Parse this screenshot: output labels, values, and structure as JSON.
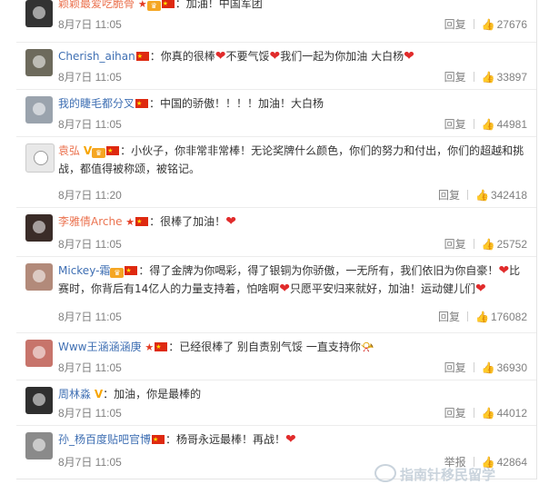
{
  "comments": [
    {
      "username": "颖颖最爱吃脆骨",
      "name_color": "#eb7350",
      "badges": [
        "star",
        "crown",
        "flag"
      ],
      "text": "：加油！中国军团",
      "date": "8月7日 11:05",
      "reply": "回复",
      "likes": "27676",
      "avatar_color": "#333333",
      "avatar_icon": "panda-avatar"
    },
    {
      "username": "Cherish_aihan",
      "name_color": "#3f6fb3",
      "badges": [
        "flag"
      ],
      "text_parts": [
        "：你真的很棒",
        "不要气馁",
        "我们一起为你加油 大白杨",
        ""
      ],
      "date": "8月7日 11:05",
      "reply": "回复",
      "likes": "33897",
      "avatar_color": "#6d6a5c",
      "avatar_icon": "user-avatar"
    },
    {
      "username": "我的睫毛都分叉",
      "name_color": "#3f6fb3",
      "badges": [
        "flag"
      ],
      "text": "：中国的骄傲！！！！加油！大白杨",
      "date": "8月7日 11:05",
      "reply": "回复",
      "likes": "44981",
      "avatar_color": "#9aa3ad",
      "avatar_icon": "user-avatar"
    },
    {
      "username": "袁弘",
      "name_color": "#eb7350",
      "badges": [
        "v",
        "crown",
        "flag"
      ],
      "text": "：小伙子，你非常非常棒！无论奖牌什么颜色，你们的努力和付出，你们的超越和挑战，都值得被称颂，被铭记。",
      "date": "8月7日 11:20",
      "reply": "回复",
      "likes": "342418",
      "avatar_color": "#d8d8d8",
      "avatar_icon": "cat-sketch-avatar"
    },
    {
      "username": "李雅倩Arche",
      "name_color": "#eb7350",
      "badges": [
        "star",
        "flag"
      ],
      "text": "：很棒了加油！",
      "date": "8月7日 11:05",
      "reply": "回复",
      "likes": "25752",
      "avatar_color": "#3a2c28",
      "avatar_icon": "user-avatar"
    },
    {
      "username": "Mickey-霜",
      "name_color": "#3f6fb3",
      "badges": [
        "crown",
        "flag"
      ],
      "text_parts": [
        "：得了金牌为你喝彩，得了银铜为你骄傲，一无所有，我们依旧为你自豪！",
        "比赛时，你背后有14亿人的力量支持着，怕啥啊",
        "只愿平安归来就好，加油！运动健儿们",
        ""
      ],
      "date": "8月7日 11:05",
      "reply": "回复",
      "likes": "176082",
      "avatar_color": "#b28a7a",
      "avatar_icon": "user-avatar"
    },
    {
      "username": "Www王涵涵涵庚",
      "name_color": "#3f6fb3",
      "badges": [
        "star",
        "flag"
      ],
      "text": "：已经很棒了 别自责别气馁 一直支持你",
      "date": "8月7日 11:05",
      "reply": "回复",
      "likes": "36930",
      "avatar_color": "#c7746b",
      "avatar_icon": "user-avatar"
    },
    {
      "username": "周林淼",
      "name_color": "#3f6fb3",
      "badges": [
        "v"
      ],
      "text": "：加油，你是最棒的",
      "date": "8月7日 11:05",
      "reply": "回复",
      "likes": "44012",
      "avatar_color": "#2f2f2f",
      "avatar_icon": "user-avatar"
    },
    {
      "username": "孙_杨百度贴吧官博",
      "name_color": "#3f6fb3",
      "badges": [
        "flag"
      ],
      "text": "：杨哥永远最棒！再战！",
      "date": "8月7日 11:05",
      "reply": "举报",
      "likes": "42864",
      "avatar_color": "#8a8a8a",
      "avatar_icon": "user-avatar"
    }
  ],
  "watermark": "指南针移民留学"
}
